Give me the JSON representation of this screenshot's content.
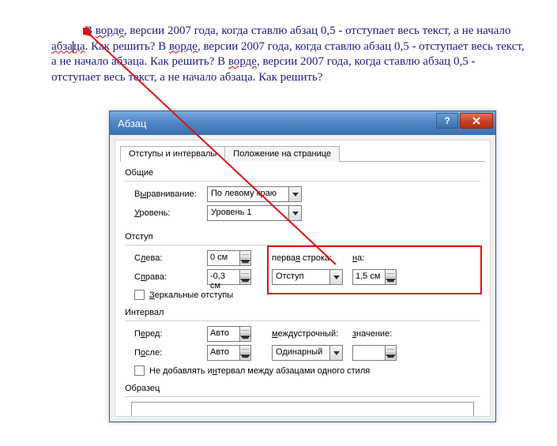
{
  "doc": {
    "text_prefix": "В ",
    "w_vorde": "ворде",
    "text_mid1": ", версии 2007 года, когда ставлю абзац 0,5 - отступает весь текст, а не начало ",
    "w_abzaca1": "абза",
    "w_abzaca2": "ца",
    "text_mid2": ". Как решить? В ",
    "w_vorde2": "ворде",
    "text_mid3": ", версии 2007 года, когда ставлю абзац 0,5 - отступает весь текст, а не начало абзаца. Как решить? В ",
    "w_vorde3": "ворде",
    "text_mid4": ", версии 2007 года, когда ставлю абзац 0,5 - отступает весь текст, а не начало абзаца. Как решить?"
  },
  "dialog": {
    "title": "Абзац",
    "help": "?",
    "close": "X",
    "tabs": {
      "t1": "Отступы и интервалы",
      "t2": "Положение на странице"
    },
    "general": {
      "label": "Общие",
      "align_label_pre": "В",
      "align_label_und": "ы",
      "align_label_post": "равнивание:",
      "align_value": "По левому краю",
      "level_label_pre": "",
      "level_label_und": "У",
      "level_label_post": "ровень:",
      "level_value": "Уровень 1"
    },
    "indent": {
      "label": "Отступ",
      "left_pre": "С",
      "left_und": "л",
      "left_post": "ева:",
      "left_value": "0 см",
      "right_pre": "С",
      "right_und": "п",
      "right_post": "рава:",
      "right_value": "-0,3 см",
      "firstline_pre": "перва",
      "firstline_und": "я",
      "firstline_post": " строка:",
      "firstline_value": "Отступ",
      "on_und": "н",
      "on_post": "а:",
      "on_value": "1,5 см",
      "mirror_und": "З",
      "mirror_post": "еркальные отступы"
    },
    "spacing": {
      "label": "Интервал",
      "before_pre": "П",
      "before_und": "е",
      "before_post": "ред:",
      "before_value": "Авто",
      "after_pre": "П",
      "after_und": "о",
      "after_post": "сле:",
      "after_value": "Авто",
      "linespace_und": "м",
      "linespace_post": "еждустрочный:",
      "linespace_value": "Одинарный",
      "val_und": "з",
      "val_post": "начение:",
      "val_value": "",
      "nospace_pre": "Не добавлять и",
      "nospace_und": "н",
      "nospace_post": "тервал между абзацами одного стиля"
    },
    "preview": {
      "label": "Образец"
    }
  }
}
